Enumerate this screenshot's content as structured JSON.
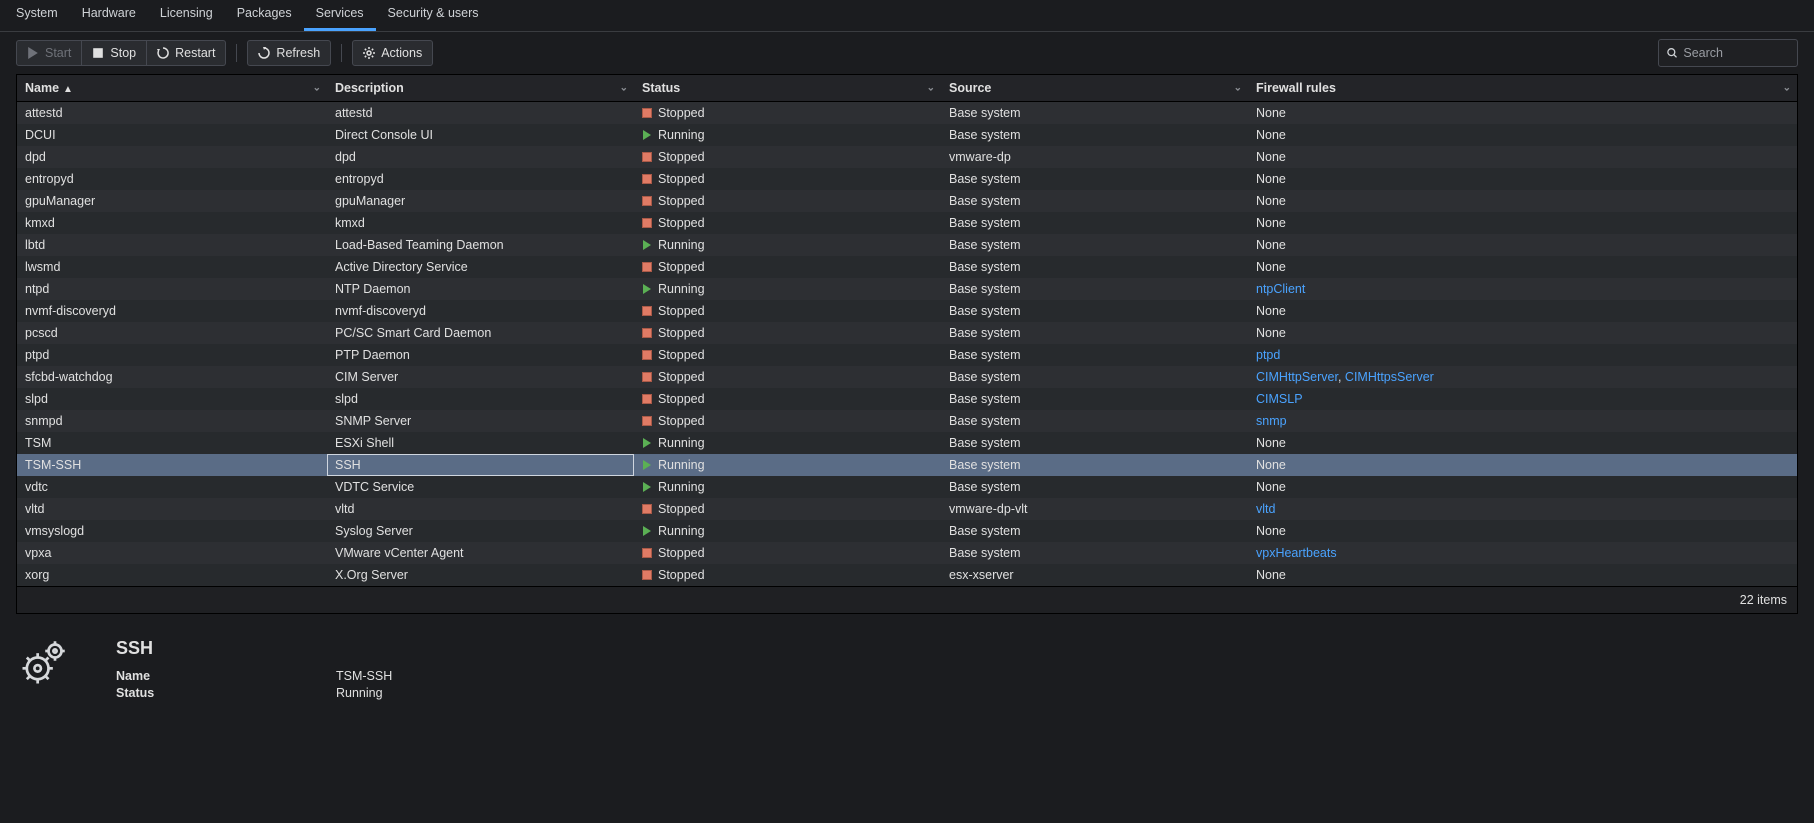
{
  "tabs": [
    "System",
    "Hardware",
    "Licensing",
    "Packages",
    "Services",
    "Security & users"
  ],
  "active_tab_index": 4,
  "toolbar": {
    "start": "Start",
    "stop": "Stop",
    "restart": "Restart",
    "refresh": "Refresh",
    "actions": "Actions"
  },
  "search": {
    "placeholder": "Search"
  },
  "columns": [
    "Name",
    "Description",
    "Status",
    "Source",
    "Firewall rules"
  ],
  "sort_col": 0,
  "rows": [
    {
      "name": "attestd",
      "desc": "attestd",
      "status": "Stopped",
      "source": "Base system",
      "fw": [
        {
          "t": "None"
        }
      ]
    },
    {
      "name": "DCUI",
      "desc": "Direct Console UI",
      "status": "Running",
      "source": "Base system",
      "fw": [
        {
          "t": "None"
        }
      ]
    },
    {
      "name": "dpd",
      "desc": "dpd",
      "status": "Stopped",
      "source": "vmware-dp",
      "fw": [
        {
          "t": "None"
        }
      ]
    },
    {
      "name": "entropyd",
      "desc": "entropyd",
      "status": "Stopped",
      "source": "Base system",
      "fw": [
        {
          "t": "None"
        }
      ]
    },
    {
      "name": "gpuManager",
      "desc": "gpuManager",
      "status": "Stopped",
      "source": "Base system",
      "fw": [
        {
          "t": "None"
        }
      ]
    },
    {
      "name": "kmxd",
      "desc": "kmxd",
      "status": "Stopped",
      "source": "Base system",
      "fw": [
        {
          "t": "None"
        }
      ]
    },
    {
      "name": "lbtd",
      "desc": "Load-Based Teaming Daemon",
      "status": "Running",
      "source": "Base system",
      "fw": [
        {
          "t": "None"
        }
      ]
    },
    {
      "name": "lwsmd",
      "desc": "Active Directory Service",
      "status": "Stopped",
      "source": "Base system",
      "fw": [
        {
          "t": "None"
        }
      ]
    },
    {
      "name": "ntpd",
      "desc": "NTP Daemon",
      "status": "Running",
      "source": "Base system",
      "fw": [
        {
          "t": "ntpClient",
          "link": true
        }
      ]
    },
    {
      "name": "nvmf-discoveryd",
      "desc": "nvmf-discoveryd",
      "status": "Stopped",
      "source": "Base system",
      "fw": [
        {
          "t": "None"
        }
      ]
    },
    {
      "name": "pcscd",
      "desc": "PC/SC Smart Card Daemon",
      "status": "Stopped",
      "source": "Base system",
      "fw": [
        {
          "t": "None"
        }
      ]
    },
    {
      "name": "ptpd",
      "desc": "PTP Daemon",
      "status": "Stopped",
      "source": "Base system",
      "fw": [
        {
          "t": "ptpd",
          "link": true
        }
      ]
    },
    {
      "name": "sfcbd-watchdog",
      "desc": "CIM Server",
      "status": "Stopped",
      "source": "Base system",
      "fw": [
        {
          "t": "CIMHttpServer",
          "link": true
        },
        {
          "t": "CIMHttpsServer",
          "link": true
        }
      ]
    },
    {
      "name": "slpd",
      "desc": "slpd",
      "status": "Stopped",
      "source": "Base system",
      "fw": [
        {
          "t": "CIMSLP",
          "link": true
        }
      ]
    },
    {
      "name": "snmpd",
      "desc": "SNMP Server",
      "status": "Stopped",
      "source": "Base system",
      "fw": [
        {
          "t": "snmp",
          "link": true
        }
      ]
    },
    {
      "name": "TSM",
      "desc": "ESXi Shell",
      "status": "Running",
      "source": "Base system",
      "fw": [
        {
          "t": "None"
        }
      ]
    },
    {
      "name": "TSM-SSH",
      "desc": "SSH",
      "status": "Running",
      "source": "Base system",
      "fw": [
        {
          "t": "None"
        }
      ],
      "selected": true
    },
    {
      "name": "vdtc",
      "desc": "VDTC Service",
      "status": "Running",
      "source": "Base system",
      "fw": [
        {
          "t": "None"
        }
      ]
    },
    {
      "name": "vltd",
      "desc": "vltd",
      "status": "Stopped",
      "source": "vmware-dp-vlt",
      "fw": [
        {
          "t": "vltd",
          "link": true
        }
      ]
    },
    {
      "name": "vmsyslogd",
      "desc": "Syslog Server",
      "status": "Running",
      "source": "Base system",
      "fw": [
        {
          "t": "None"
        }
      ]
    },
    {
      "name": "vpxa",
      "desc": "VMware vCenter Agent",
      "status": "Stopped",
      "source": "Base system",
      "fw": [
        {
          "t": "vpxHeartbeats",
          "link": true
        }
      ]
    },
    {
      "name": "xorg",
      "desc": "X.Org Server",
      "status": "Stopped",
      "source": "esx-xserver",
      "fw": [
        {
          "t": "None"
        }
      ]
    }
  ],
  "footer_count": "22 items",
  "detail": {
    "title": "SSH",
    "name_label": "Name",
    "name_value": "TSM-SSH",
    "status_label": "Status",
    "status_value": "Running"
  }
}
